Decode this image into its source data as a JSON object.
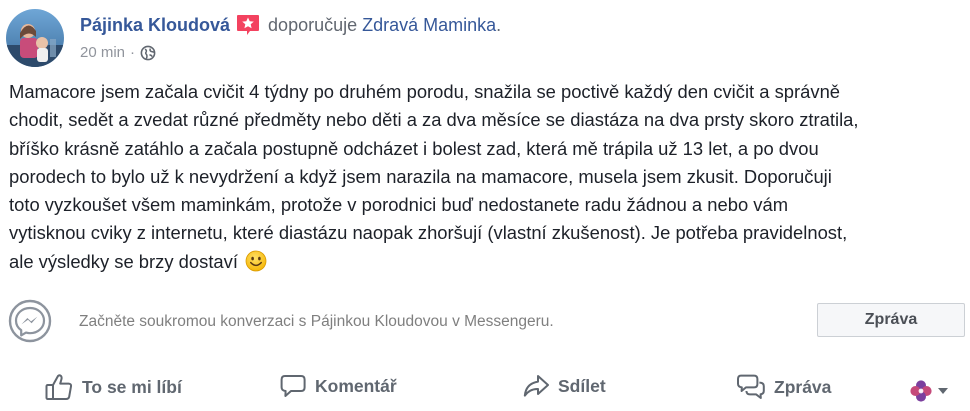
{
  "post": {
    "author": "Pájinka Kloudová",
    "recommends_text": "doporučuje",
    "page_name": "Zdravá Maminka",
    "head_dot": ".",
    "time": "20 min",
    "meta_separator": "·",
    "text_lines": [
      "Mamacore jsem začala cvičit 4 týdny po druhém porodu, snažila se poctivě každý den cvičit a správně",
      "chodit, sedět a zvedat různé předměty nebo děti a za dva měsíce se diastáza na dva prsty skoro ztratila,",
      "bříško krásně zatáhlo a začala postupně odcházet i bolest zad, která mě trápila už 13 let, a po dvou",
      "porodech to bylo už k nevydržení a když jsem narazila na mamacore, musela jsem zkusit. Doporučuji",
      "toto vyzkoušet všem maminkám, protože v porodnici buď nedostanete radu žádnou a nebo vám",
      "vytisknou cviky z internetu, které diastázu naopak zhoršují (vlastní zkušenost). Je potřeba pravidelnost,",
      "ale výsledky se brzy dostaví"
    ]
  },
  "messenger": {
    "prompt": "Začněte soukromou konverzaci s Pájinkou Kloudovou v Messengeru.",
    "button_label": "Zpráva"
  },
  "actions": {
    "like": "To se mi líbí",
    "comment": "Komentář",
    "share": "Sdílet",
    "message": "Zpráva"
  },
  "colors": {
    "link": "#365899",
    "star_badge": "#f3425f",
    "secondary_text": "#90949c",
    "action_text": "#606770"
  },
  "icons": {
    "author_badge": "star-badge-icon",
    "privacy": "globe-icon",
    "messenger": "messenger-icon",
    "like": "thumbs-up-icon",
    "comment": "comment-icon",
    "share": "share-icon",
    "message": "message-icon",
    "reactions": "reactions-flower-icon",
    "dropdown": "caret-down-icon",
    "emoji": "smiley-emoji-icon"
  }
}
